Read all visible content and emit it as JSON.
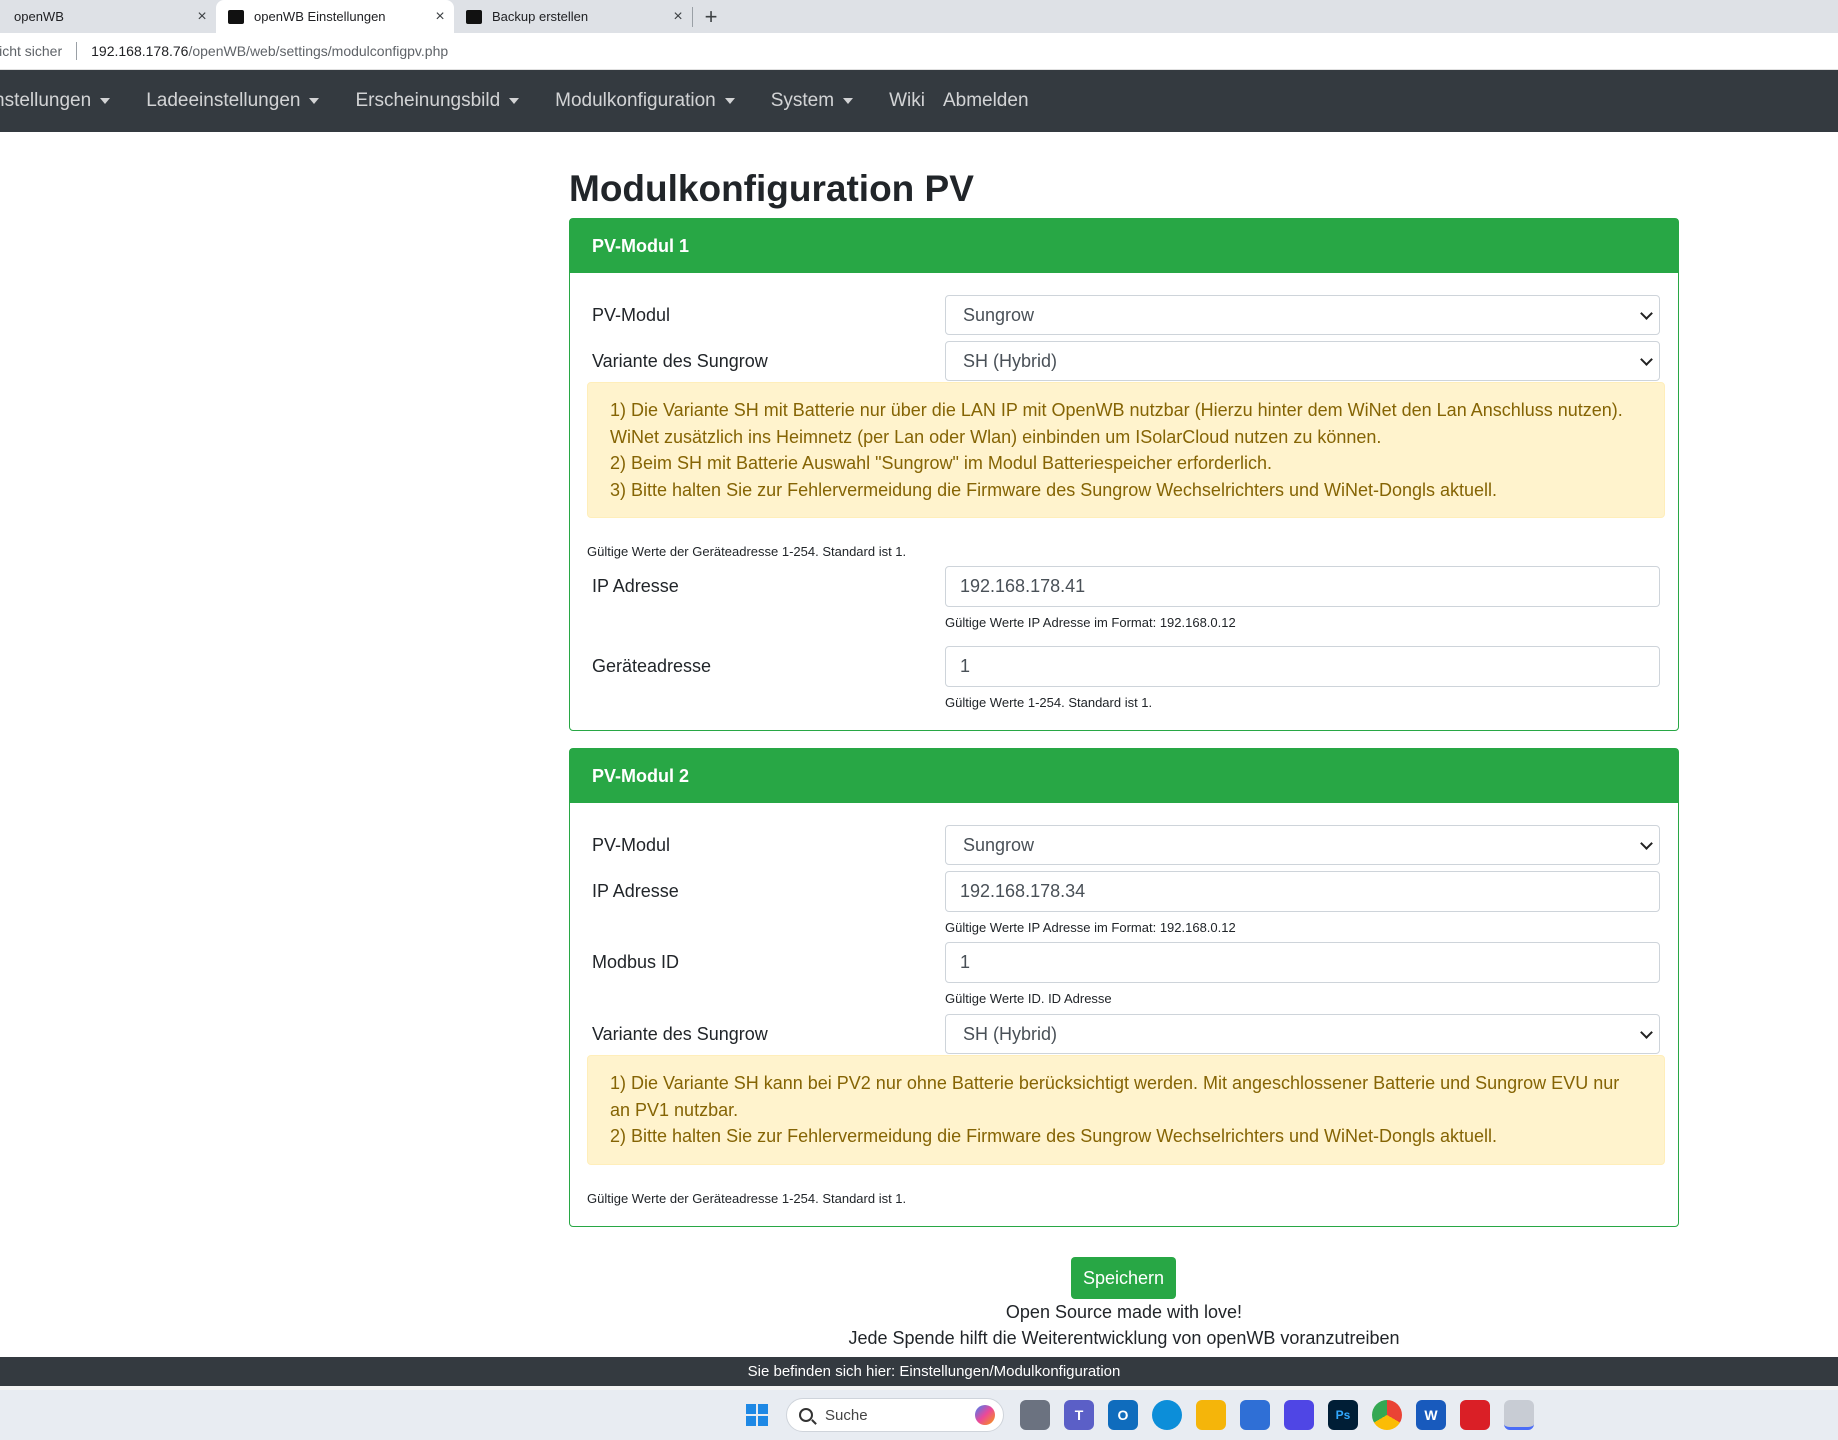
{
  "browser": {
    "tabs": [
      {
        "label": "openWB"
      },
      {
        "label": "openWB Einstellungen"
      },
      {
        "label": "Backup erstellen"
      }
    ],
    "close_glyph": "×",
    "newtab_glyph": "+",
    "security_label": "licht sicher",
    "url_host": "192.168.178.76",
    "url_path": "/openWB/web/settings/modulconfigpv.php"
  },
  "nav": {
    "items": [
      {
        "label": "nstellungen",
        "dropdown": true
      },
      {
        "label": "Ladeeinstellungen",
        "dropdown": true
      },
      {
        "label": "Erscheinungsbild",
        "dropdown": true
      },
      {
        "label": "Modulkonfiguration",
        "dropdown": true
      },
      {
        "label": "System",
        "dropdown": true
      },
      {
        "label": "Wiki",
        "dropdown": false
      },
      {
        "label": "Abmelden",
        "dropdown": false
      }
    ]
  },
  "page": {
    "title": "Modulkonfiguration PV"
  },
  "pv1": {
    "header": "PV-Modul 1",
    "module_label": "PV-Modul",
    "module_value": "Sungrow",
    "variant_label": "Variante des Sungrow",
    "variant_value": "SH (Hybrid)",
    "alert_lines": [
      "1) Die Variante SH mit Batterie nur über die LAN IP mit OpenWB nutzbar (Hierzu hinter dem WiNet den Lan Anschluss nutzen).",
      "WiNet zusätzlich ins Heimnetz (per Lan oder Wlan) einbinden um ISolarCloud nutzen zu können.",
      "2) Beim SH mit Batterie Auswahl \"Sungrow\" im Modul Batteriespeicher erforderlich.",
      "3) Bitte halten Sie zur Fehlervermeidung die Firmware des Sungrow Wechselrichters und WiNet-Dongls aktuell."
    ],
    "device_help_top": "Gültige Werte der Geräteadresse 1-254. Standard ist 1.",
    "ip_label": "IP Adresse",
    "ip_value": "192.168.178.41",
    "ip_help": "Gültige Werte IP Adresse im Format: 192.168.0.12",
    "device_label": "Geräteadresse",
    "device_value": "1",
    "device_help": "Gültige Werte 1-254. Standard ist 1."
  },
  "pv2": {
    "header": "PV-Modul 2",
    "module_label": "PV-Modul",
    "module_value": "Sungrow",
    "ip_label": "IP Adresse",
    "ip_value": "192.168.178.34",
    "ip_help": "Gültige Werte IP Adresse im Format: 192.168.0.12",
    "modbus_label": "Modbus ID",
    "modbus_value": "1",
    "modbus_help": "Gültige Werte ID. ID Adresse",
    "variant_label": "Variante des Sungrow",
    "variant_value": "SH (Hybrid)",
    "alert_lines": [
      "1) Die Variante SH kann bei PV2 nur ohne Batterie berücksichtigt werden. Mit angeschlossener Batterie und Sungrow EVU nur an PV1 nutzbar.",
      "2) Bitte halten Sie zur Fehlervermeidung die Firmware des Sungrow Wechselrichters und WiNet-Dongls aktuell."
    ],
    "device_help_bottom": "Gültige Werte der Geräteadresse 1-254. Standard ist 1."
  },
  "actions": {
    "save_label": "Speichern"
  },
  "footer": {
    "line1": "Open Source made with love!",
    "line2": "Jede Spende hilft die Weiterentwicklung von openWB voranzutreiben"
  },
  "statusbar": {
    "text": "Sie befinden sich hier: Einstellungen/Modulkonfiguration"
  },
  "taskbar": {
    "search_label": "Suche",
    "icons": [
      "windows-start-icon",
      "task-view-icon",
      "teams-icon",
      "outlook-icon",
      "edge-icon",
      "file-explorer-icon",
      "store-icon",
      "app-icon",
      "photoshop-icon",
      "chrome-icon",
      "word-icon",
      "creative-cloud-icon",
      "snipping-tool-icon"
    ]
  }
}
